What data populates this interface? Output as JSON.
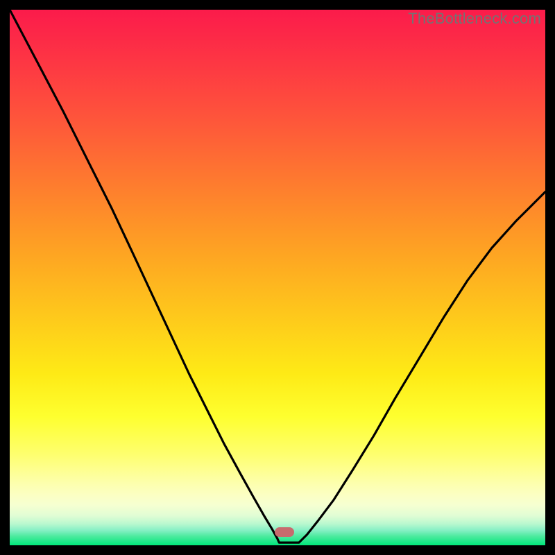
{
  "watermark": "TheBottleneck.com",
  "colors": {
    "top": "#fb1b4b",
    "upper_mid": "#fe782f",
    "mid": "#fedf19",
    "lower_mid": "#feff56",
    "pale_band_top": "#fdffb5",
    "pale_band_bottom": "#f3ffd8",
    "teal": "#8cf1c8",
    "green": "#00e77a",
    "curve": "#000000",
    "marker": "#c76b6e",
    "background": "#000000"
  },
  "marker": {
    "x_frac": 0.513,
    "y_frac": 0.975
  },
  "chart_data": {
    "type": "line",
    "title": "",
    "xlabel": "",
    "ylabel": "",
    "xlim": [
      0,
      1
    ],
    "ylim": [
      0,
      1
    ],
    "series": [
      {
        "name": "left-branch",
        "x": [
          0.0,
          0.05,
          0.1,
          0.145,
          0.19,
          0.23,
          0.265,
          0.3,
          0.335,
          0.37,
          0.4,
          0.43,
          0.455,
          0.475,
          0.49,
          0.5,
          0.503
        ],
        "y": [
          1.0,
          0.905,
          0.81,
          0.72,
          0.63,
          0.545,
          0.47,
          0.395,
          0.32,
          0.25,
          0.19,
          0.135,
          0.09,
          0.055,
          0.03,
          0.012,
          0.005
        ]
      },
      {
        "name": "right-branch",
        "x": [
          0.54,
          0.555,
          0.575,
          0.605,
          0.64,
          0.68,
          0.72,
          0.765,
          0.81,
          0.855,
          0.9,
          0.945,
          0.98,
          1.0
        ],
        "y": [
          0.005,
          0.02,
          0.045,
          0.085,
          0.14,
          0.205,
          0.275,
          0.35,
          0.425,
          0.495,
          0.555,
          0.605,
          0.64,
          0.66
        ]
      },
      {
        "name": "valley-floor",
        "x": [
          0.503,
          0.54
        ],
        "y": [
          0.005,
          0.005
        ]
      }
    ],
    "annotations": [
      {
        "name": "minimum-marker",
        "x": 0.513,
        "y": 0.005
      }
    ]
  }
}
